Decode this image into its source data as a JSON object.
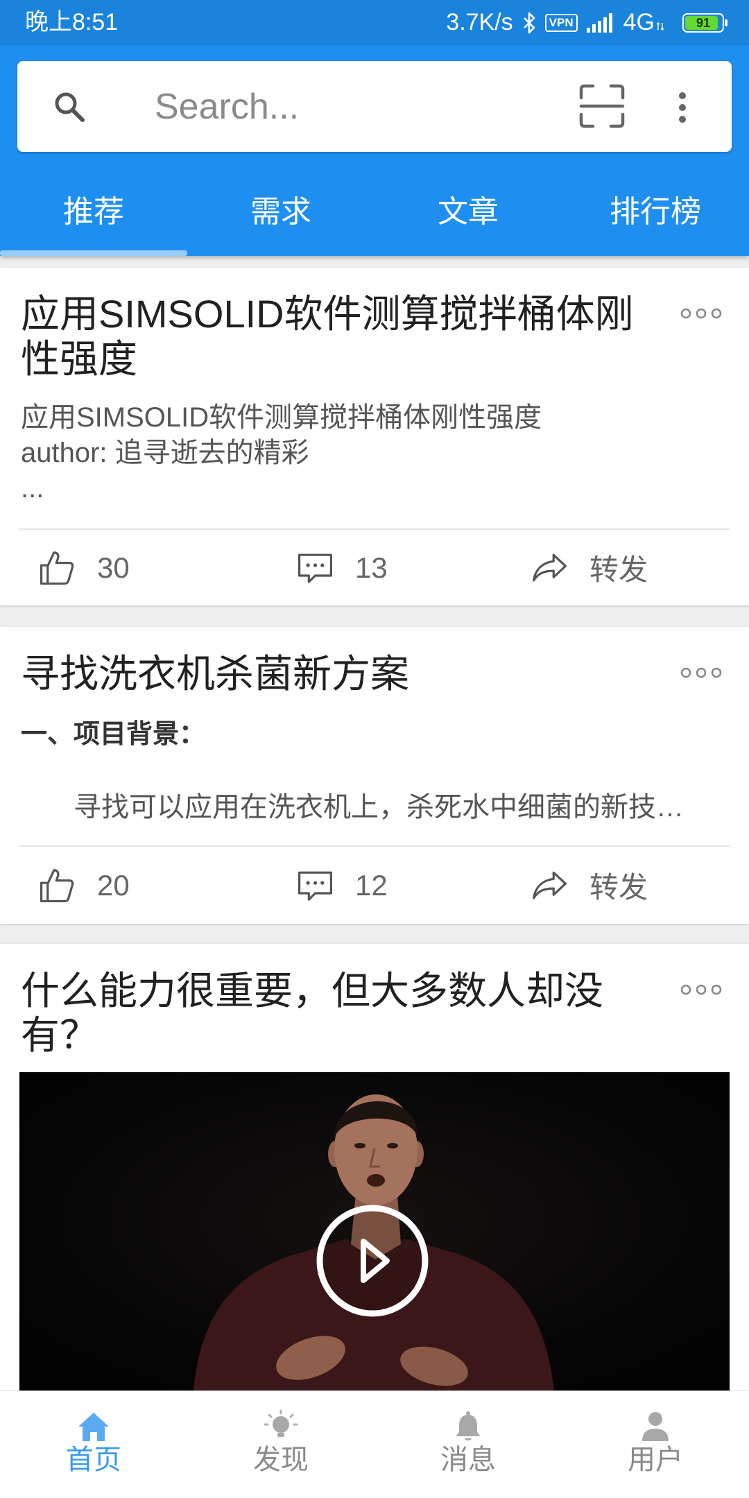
{
  "status_bar": {
    "time": "晚上8:51",
    "net_speed": "3.7K/s",
    "vpn": "VPN",
    "network": "4G",
    "battery": "91"
  },
  "search": {
    "placeholder": "Search...",
    "icon": "search-icon",
    "scan_icon": "scan-icon",
    "more_icon": "more-vertical-icon"
  },
  "tabs": [
    {
      "label": "推荐",
      "active": true
    },
    {
      "label": "需求",
      "active": false
    },
    {
      "label": "文章",
      "active": false
    },
    {
      "label": "排行榜",
      "active": false
    }
  ],
  "feed": [
    {
      "title_lines": [
        "应用SIMSOLID软件测算搅拌桶体刚",
        "性强度"
      ],
      "summary_lines": [
        "应用SIMSOLID软件测算搅拌桶体刚性强度",
        "author: 追寻逝去的精彩",
        "..."
      ],
      "likes": "30",
      "comments": "13",
      "share_label": "转发"
    },
    {
      "title_lines": [
        "寻找洗衣机杀菌新方案"
      ],
      "section_heading": "一、项目背景：",
      "summary_lines": [
        "寻找可以应用在洗衣机上，杀死水中细菌的新技…"
      ],
      "likes": "20",
      "comments": "12",
      "share_label": "转发"
    },
    {
      "title_lines": [
        "什么能力很重要，但大多数人却没",
        "有？"
      ],
      "media": {
        "type": "video",
        "play_icon": "play-circle-icon"
      }
    }
  ],
  "bottom_nav": [
    {
      "label": "首页",
      "icon": "home-icon",
      "active": true
    },
    {
      "label": "发现",
      "icon": "discover-icon",
      "active": false
    },
    {
      "label": "消息",
      "icon": "bell-icon",
      "active": false
    },
    {
      "label": "用户",
      "icon": "user-icon",
      "active": false
    }
  ],
  "colors": {
    "primary": "#1e8ff0",
    "status_bar": "#1a83dc",
    "active_nav": "#3a9ae8",
    "battery": "#62d936"
  }
}
